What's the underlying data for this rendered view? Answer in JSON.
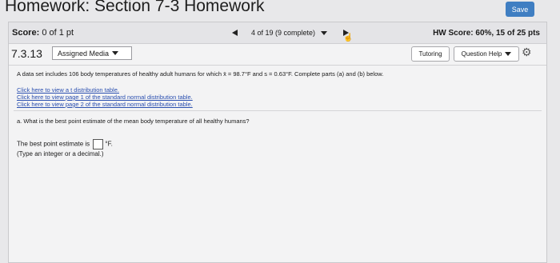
{
  "header": {
    "title": "Homework: Section 7-3 Homework",
    "save_label": "Save"
  },
  "score_bar": {
    "score_label": "Score:",
    "score_value": "0 of 1 pt",
    "progress": "4 of 19 (9 complete)",
    "hw_score": "HW Score: 60%, 15 of 25 pts"
  },
  "question_bar": {
    "number": "7.3.13",
    "media_label": "Assigned Media",
    "tutoring_label": "Tutoring",
    "help_label": "Question Help"
  },
  "content": {
    "prompt": "A data set includes 106 body temperatures of healthy adult humans for which x̄ = 98.7°F and s = 0.63°F. Complete parts (a) and (b) below.",
    "links": [
      "Click here to view a t distribution table.",
      "Click here to view page 1 of the standard normal distribution table.",
      "Click here to view page 2 of the standard normal distribution table."
    ],
    "question_a": "a. What is the best point estimate of the mean body temperature of all healthy humans?",
    "answer_prefix": "The best point estimate is",
    "answer_unit": "°F.",
    "answer_hint": "(Type an integer or a decimal.)"
  }
}
